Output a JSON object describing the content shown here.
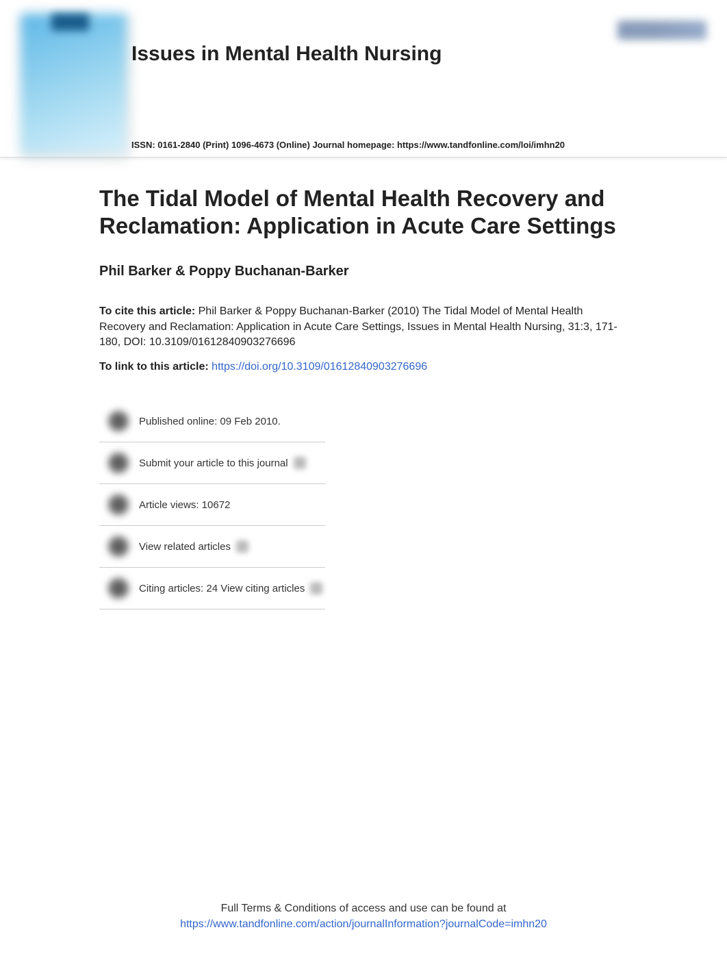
{
  "header": {
    "journal_title": "Issues in Mental Health Nursing",
    "issn_line": "ISSN: 0161-2840 (Print) 1096-4673 (Online) Journal homepage: https://www.tandfonline.com/loi/imhn20"
  },
  "article": {
    "title": "The Tidal Model of Mental Health Recovery and Reclamation: Application in Acute Care Settings",
    "authors": "Phil Barker & Poppy Buchanan-Barker",
    "cite_label": "To cite this article:",
    "cite_text": " Phil Barker & Poppy Buchanan-Barker (2010) The Tidal Model of Mental Health Recovery and Reclamation: Application in Acute Care Settings, Issues in Mental Health Nursing, 31:3, 171-180, DOI: 10.3109/01612840903276696",
    "link_label": "To link to this article: ",
    "link_url": "https://doi.org/10.3109/01612840903276696"
  },
  "actions": {
    "published": "Published online: 09 Feb 2010.",
    "submit": "Submit your article to this journal",
    "views": "Article views: 10672",
    "related": "View related articles",
    "citing": "Citing articles: 24 View citing articles"
  },
  "footer": {
    "line1": "Full Terms & Conditions of access and use can be found at",
    "line2": "https://www.tandfonline.com/action/journalInformation?journalCode=imhn20"
  }
}
